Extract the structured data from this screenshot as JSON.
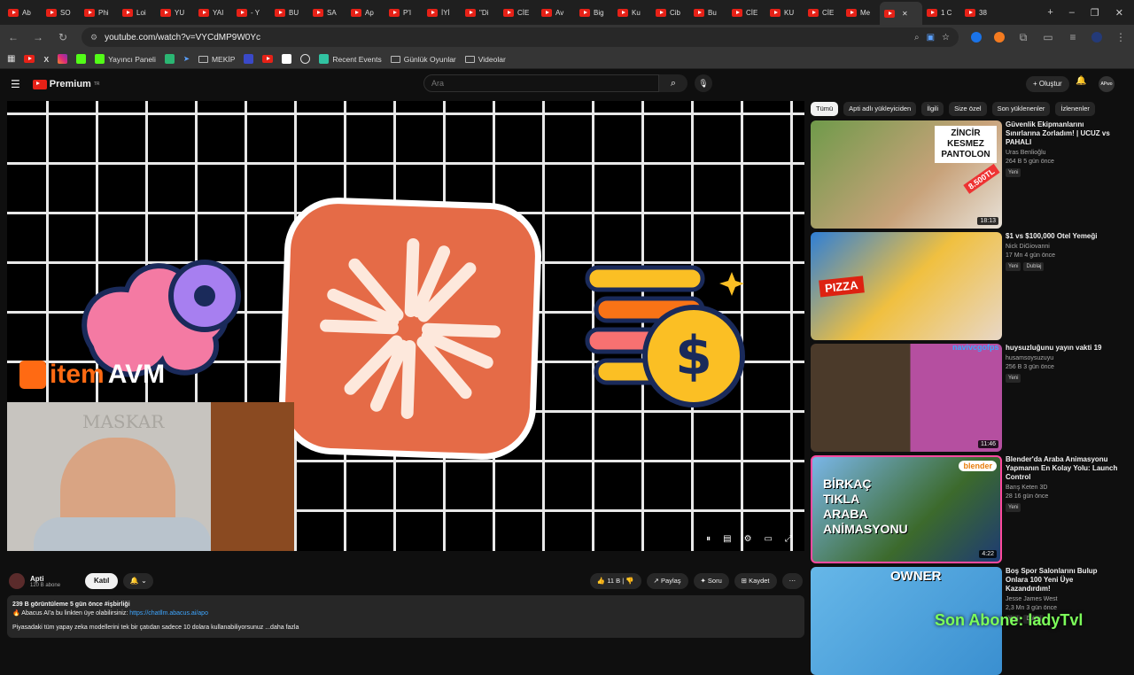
{
  "browser": {
    "tabs": [
      "Ab",
      "SO",
      "Phi",
      "Loi",
      "YU",
      "YAI",
      "- Y",
      "BU",
      "SA",
      "Ap",
      "P'I",
      "İYİ",
      "\"Di",
      "CİE",
      "Av",
      "Big",
      "Ku",
      "Cib",
      "Bu",
      "CİE",
      "KU",
      "CİE",
      "Me",
      "",
      "1 C",
      "38"
    ],
    "active_tab_index": 23,
    "url": "youtube.com/watch?v=VYCdMP9W0Yc",
    "bookmarks": [
      "Yayıncı Paneli",
      "MEKİP",
      "Recent Events",
      "Günlük Oyunlar",
      "Videolar"
    ]
  },
  "youtube": {
    "logo": "Premium",
    "logo_sup": "TR",
    "search_placeholder": "Ara",
    "create_label": "+ Oluştur",
    "avatar_text": "APwo"
  },
  "player": {
    "overlay_brand_1": "item",
    "overlay_brand_2": "AVM",
    "webcam_label": "MASKAR"
  },
  "chips": [
    "Tümü",
    "Apti adlı yükleyiciden",
    "İlgili",
    "Size özel",
    "Son yüklenenler",
    "İzlenenler"
  ],
  "recommendations": [
    {
      "title": "Güvenlik Ekipmanlarını Sınırlarına Zorladım! | UCUZ vs PAHALI",
      "channel": "Uras Benlioğlu",
      "stats": "264 B  5 gün önce",
      "badge": "Yeni",
      "duration": "18:13",
      "thumb_text": "ZİNCİR KESMEZ PANTOLON",
      "thumb_price": "8.500TL"
    },
    {
      "title": "$1 vs $100,000 Otel Yemeği",
      "channel": "Nick DiGiovanni",
      "stats": "17 Mn  4 gün önce",
      "badge": "Yeni",
      "badge2": "Dublaj",
      "duration": "",
      "thumb_text": "PIZZA"
    },
    {
      "title": "huysuzluğunu yayın vakti 19",
      "channel": "husamsoysuzuyu",
      "stats": "256 B  3 gün önce",
      "badge": "Yeni",
      "duration": "11:46",
      "thumb_text": "navivcgofps"
    },
    {
      "title": "Blender'da Araba Animasyonu Yapmanın En Kolay Yolu: Launch Control",
      "channel": "Barış Keten 3D",
      "stats": "28  16 gün önce",
      "badge": "Yeni",
      "duration": "4:22",
      "thumb_text": "BİRKAÇ TIKLA ARABA ANİMASYONU",
      "thumb_brand": "blender"
    },
    {
      "title": "Boş Spor Salonlarını Bulup Onlara 100 Yeni Üye Kazandırdım!",
      "channel": "Jesse James West",
      "stats": "2,3 Mn  3 gün önce",
      "badge": "Yeni",
      "badge2": "Dublaj",
      "duration": "",
      "thumb_text": "OWNER"
    }
  ],
  "channel": {
    "name": "Apti",
    "subs": "120 B abone",
    "join": "Katıl",
    "like": "11 B",
    "share": "Paylaş",
    "ask": "Soru",
    "save": "Kaydet"
  },
  "description": {
    "stats": "239 B görüntüleme  5 gün önce  #işbirliği",
    "line1": "Abacus AI'a bu linkten üye olabilirsiniz: ",
    "link": "https://chatllm.abacus.ai/apo",
    "line2": "Piyasadaki tüm yapay zeka modellerini tek bir çatıdan sadece 10 dolara kullanabiliyorsunuz   ...daha fazla"
  },
  "overlay_subscriber": "Son Abone: ladyTvl",
  "colors": {
    "accent": "#e62117",
    "background": "#0f0f0f",
    "link": "#3ea6ff",
    "app_icon": "#e56b47"
  }
}
